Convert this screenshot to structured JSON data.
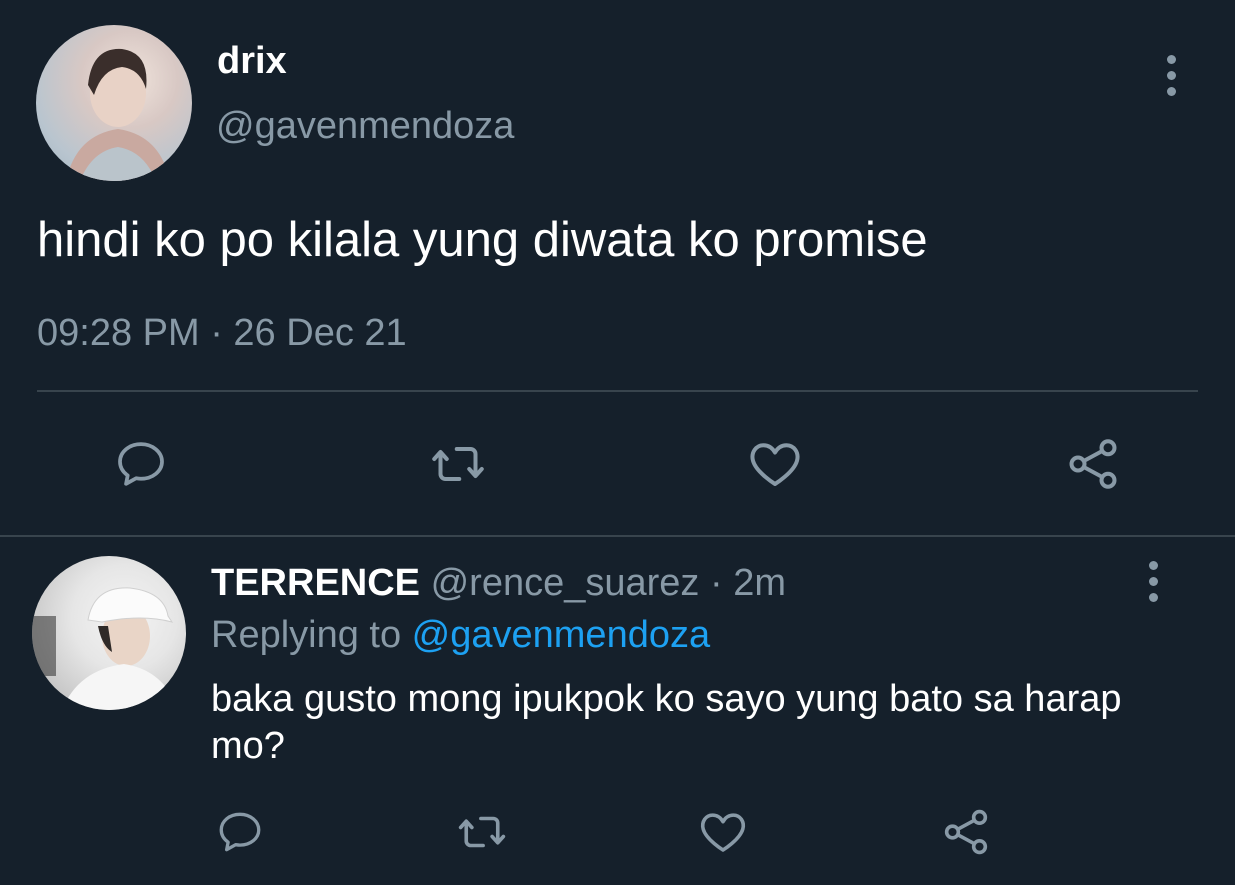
{
  "main_tweet": {
    "display_name": "drix",
    "handle": "@gavenmendoza",
    "text": "hindi ko po kilala yung diwata ko promise",
    "timestamp": "09:28 PM · 26 Dec 21",
    "actions": [
      "reply-icon",
      "retweet-icon",
      "like-icon",
      "share-icon"
    ]
  },
  "reply_tweet": {
    "display_name": "TERRENCE",
    "handle": "@rence_suarez",
    "separator": " · ",
    "time": "2m",
    "replying_to_label": "Replying to ",
    "replying_to_handle": "@gavenmendoza",
    "text": "baka gusto mong ipukpok ko sayo yung bato sa harap mo?",
    "actions": [
      "reply-icon",
      "retweet-icon",
      "like-icon",
      "share-icon"
    ]
  },
  "colors": {
    "background": "#15202b",
    "text_primary": "#ffffff",
    "text_secondary": "#8899a6",
    "accent": "#1da1f2",
    "divider": "#38444d"
  }
}
